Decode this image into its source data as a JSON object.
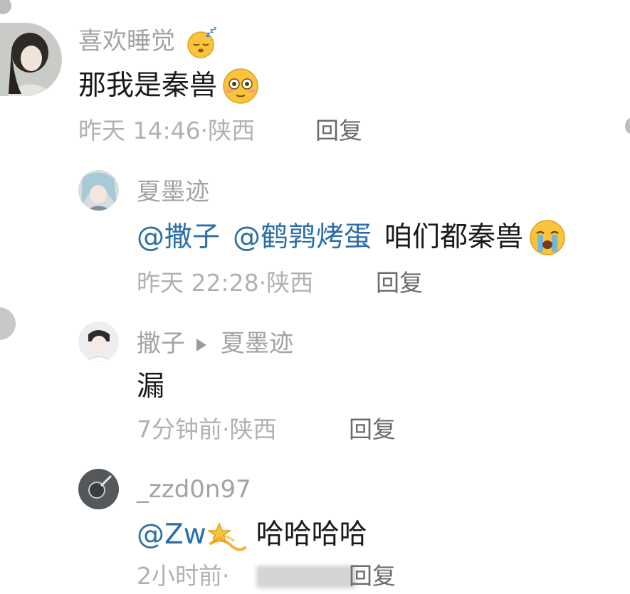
{
  "comments": [
    {
      "username": "喜欢睡觉",
      "username_emoji": "sleepy-face-emoji",
      "text": "那我是秦兽",
      "text_emoji": "flushed-face-emoji",
      "time": "昨天 14:46",
      "location": "陕西",
      "reply_label": "回复"
    },
    {
      "username": "夏墨迹",
      "mentions": [
        "@撒子",
        "@鹤鹑烤蛋"
      ],
      "text": "咱们都秦兽",
      "text_emoji": "loudly-crying-face-emoji",
      "time": "昨天 22:28",
      "location": "陕西",
      "reply_label": "回复"
    },
    {
      "username": "撒子",
      "reply_to": "夏墨迹",
      "text": "漏",
      "time": "7分钟前",
      "location": "陕西",
      "reply_label": "回复"
    },
    {
      "username": "_zzd0n97",
      "mention": "@Zw",
      "mention_emoji": "dizzy-emoji",
      "text": "哈哈哈哈",
      "time": "2小时前",
      "reply_label": "回复"
    }
  ],
  "separator": "·",
  "colors": {
    "mention": "#2b6ea8",
    "username": "#a3a3a3",
    "meta": "#b1b1b1",
    "reply": "#6b6b6b",
    "text": "#1a1a1a"
  }
}
